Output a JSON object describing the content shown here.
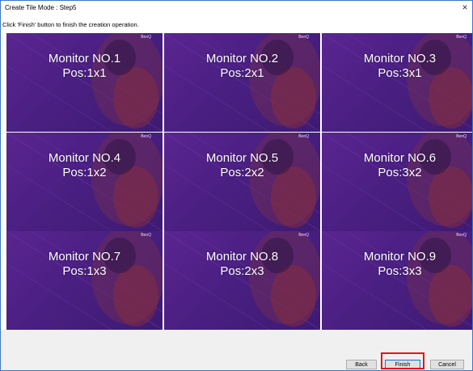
{
  "window": {
    "title": "Create Tile Mode : Step5",
    "close_glyph": "×"
  },
  "instruction": "Click 'Finish' button to finish the creation operation.",
  "tiles": [
    {
      "monitor": "Monitor NO.1",
      "pos": "Pos:1x1"
    },
    {
      "monitor": "Monitor NO.2",
      "pos": "Pos:2x1"
    },
    {
      "monitor": "Monitor NO.3",
      "pos": "Pos:3x1"
    },
    {
      "monitor": "Monitor NO.4",
      "pos": "Pos:1x2"
    },
    {
      "monitor": "Monitor NO.5",
      "pos": "Pos:2x2"
    },
    {
      "monitor": "Monitor NO.6",
      "pos": "Pos:3x2"
    },
    {
      "monitor": "Monitor NO.7",
      "pos": "Pos:1x3"
    },
    {
      "monitor": "Monitor NO.8",
      "pos": "Pos:2x3"
    },
    {
      "monitor": "Monitor NO.9",
      "pos": "Pos:3x3"
    }
  ],
  "tile_brand": "BenQ",
  "buttons": {
    "back": "Back",
    "finish": "Finish",
    "cancel": "Cancel"
  },
  "colors": {
    "tile_purple": "#4a1f82",
    "highlight_red": "#e4141b",
    "window_border": "#3a78c8"
  }
}
